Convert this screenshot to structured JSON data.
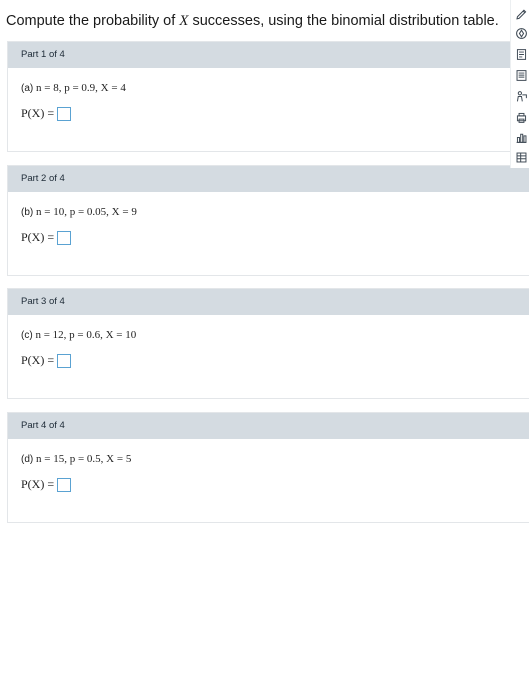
{
  "question": {
    "prefix": "Compute the probability of ",
    "variable": "X",
    "suffix": " successes, using the binomial distribution table."
  },
  "parts": [
    {
      "header": "Part 1 of 4",
      "label": "(a)",
      "params": "n = 8, p = 0.9, X = 4",
      "answer_label": "P(X) =",
      "answer_value": ""
    },
    {
      "header": "Part 2 of 4",
      "label": "(b)",
      "params": "n = 10, p = 0.05, X = 9",
      "answer_label": "P(X) =",
      "answer_value": ""
    },
    {
      "header": "Part 3 of 4",
      "label": "(c)",
      "params": "n = 12, p = 0.6, X = 10",
      "answer_label": "P(X) =",
      "answer_value": ""
    },
    {
      "header": "Part 4 of 4",
      "label": "(d)",
      "params": "n = 15, p = 0.5, X = 5",
      "answer_label": "P(X) =",
      "answer_value": ""
    }
  ],
  "toolbar": {
    "icons": [
      "pencil-icon",
      "compass-icon",
      "book-icon",
      "document-icon",
      "calculator-icon",
      "person-read-icon",
      "print-icon",
      "bar-chart-icon",
      "table-icon"
    ]
  },
  "colors": {
    "part_header_bg": "#d4dbe1",
    "answer_box_border": "#5aa2d2",
    "toolbar_icon": "#3f4a55"
  }
}
